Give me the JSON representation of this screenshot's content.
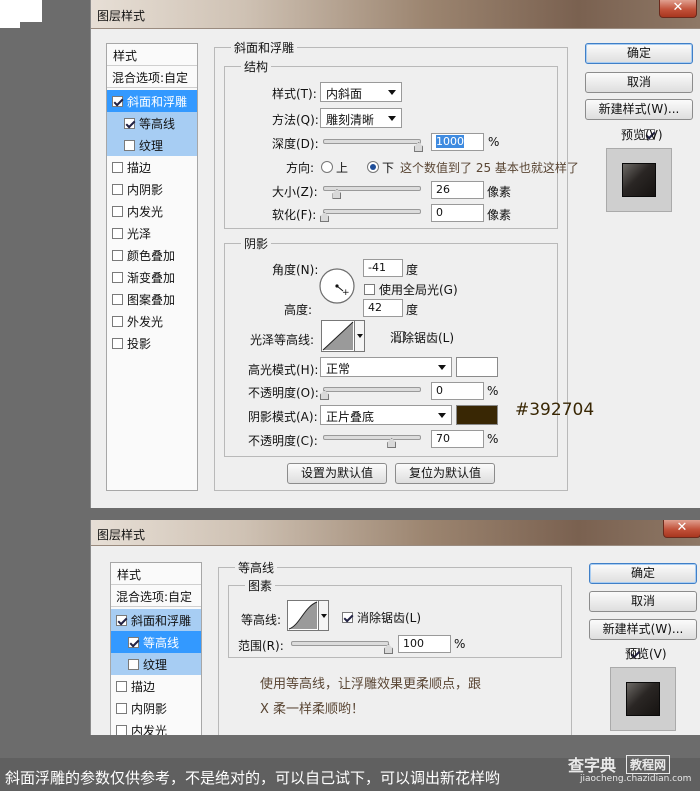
{
  "colors": {
    "shadow_swatch": "#392704",
    "highlight_swatch": "#ffffff",
    "selection": "#3399ff"
  },
  "dialog1": {
    "title": "图层样式",
    "close_glyph": "✕",
    "styles_header": "样式",
    "blend_options": "混合选项:自定",
    "items": [
      {
        "label": "斜面和浮雕",
        "checked": true
      },
      {
        "label": "等高线",
        "checked": true
      },
      {
        "label": "纹理",
        "checked": false
      },
      {
        "label": "描边",
        "checked": false
      },
      {
        "label": "内阴影",
        "checked": false
      },
      {
        "label": "内发光",
        "checked": false
      },
      {
        "label": "光泽",
        "checked": false
      },
      {
        "label": "颜色叠加",
        "checked": false
      },
      {
        "label": "渐变叠加",
        "checked": false
      },
      {
        "label": "图案叠加",
        "checked": false
      },
      {
        "label": "外发光",
        "checked": false
      },
      {
        "label": "投影",
        "checked": false
      }
    ],
    "bevel_group": "斜面和浮雕",
    "structure_group": "结构",
    "style_label": "样式(T):",
    "style_value": "内斜面",
    "technique_label": "方法(Q):",
    "technique_value": "雕刻清晰",
    "depth_label": "深度(D):",
    "depth_value": "1000",
    "depth_unit": "%",
    "depth_level": 0.98,
    "direction_label": "方向:",
    "direction_up": "上",
    "direction_down": "下",
    "direction_note": "这个数值到了 25 基本也就这样了",
    "size_label": "大小(Z):",
    "size_value": "26",
    "size_unit": "像素",
    "size_level": 0.13,
    "soften_label": "软化(F):",
    "soften_value": "0",
    "soften_unit": "像素",
    "soften_level": 0.0,
    "shading_group": "阴影",
    "angle_label": "角度(N):",
    "angle_value": "-41",
    "angle_unit": "度",
    "global_light": "使用全局光(G)",
    "altitude_label": "高度:",
    "altitude_value": "42",
    "altitude_unit": "度",
    "gloss_label": "光泽等高线:",
    "antialias": "消除锯齿(L)",
    "highlight_mode_label": "高光模式(H):",
    "highlight_mode": "正常",
    "highlight_opacity_label": "不透明度(O):",
    "highlight_opacity": "0",
    "highlight_opacity_level": 0.0,
    "shadow_mode_label": "阴影模式(A):",
    "shadow_mode": "正片叠底",
    "shadow_opacity_label": "不透明度(C):",
    "shadow_opacity": "70",
    "shadow_opacity_level": 0.7,
    "percent": "%",
    "make_default": "设置为默认值",
    "reset_default": "复位为默认值",
    "ok": "确定",
    "cancel": "取消",
    "new_style": "新建样式(W)...",
    "preview": "预览(V)",
    "hex_annotation": "#392704"
  },
  "dialog2": {
    "title": "图层样式",
    "close_glyph": "✕",
    "styles_header": "样式",
    "blend_options": "混合选项:自定",
    "items": [
      {
        "label": "斜面和浮雕",
        "checked": true
      },
      {
        "label": "等高线",
        "checked": true
      },
      {
        "label": "纹理",
        "checked": false
      },
      {
        "label": "描边",
        "checked": false
      },
      {
        "label": "内阴影",
        "checked": false
      },
      {
        "label": "内发光",
        "checked": false
      }
    ],
    "contour_group": "等高线",
    "elements_group": "图素",
    "contour_label": "等高线:",
    "antialias": "消除锯齿(L)",
    "range_label": "范围(R):",
    "range_value": "100",
    "range_unit": "%",
    "range_level": 1.0,
    "note_line1": "使用等高线，让浮雕效果更柔顺点，跟",
    "note_line2": "X 柔一样柔顺哟！",
    "ok": "确定",
    "cancel": "取消",
    "new_style": "新建样式(W)...",
    "preview": "预览(V)"
  },
  "caption": "斜面浮雕的参数仅供参考，不是绝对的，可以自己试下，可以调出新花样哟",
  "watermark": {
    "brand": "查字典",
    "sub": "教程网",
    "url": "jiaocheng.chazidian.com"
  }
}
